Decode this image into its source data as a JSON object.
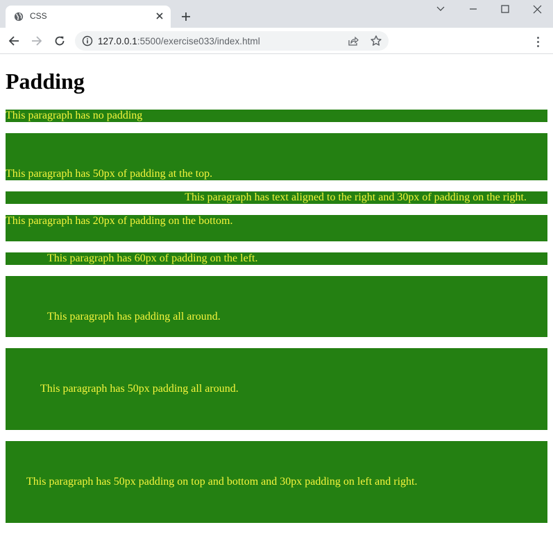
{
  "browser": {
    "tab": {
      "title": "CSS",
      "icon": "globe-icon"
    },
    "new_tab_label": "+",
    "address": {
      "host": "127.0.0.1",
      "rest": ":5500/exercise033/index.html"
    },
    "window_controls": [
      "chevron-down-icon",
      "minimize-icon",
      "maximize-icon",
      "close-icon"
    ]
  },
  "page": {
    "heading": "Padding",
    "paragraphs": [
      "This paragraph has no padding",
      "This paragraph has 50px of padding at the top.",
      "This paragraph has text aligned to the right and 30px of padding on the right.",
      "This paragraph has 20px of padding on the bottom.",
      "This paragraph has 60px of padding on the left.",
      "This paragraph has padding all around.",
      "This paragraph has 50px padding all around.",
      "This paragraph has 50px padding on top and bottom and 30px padding on left and right."
    ]
  },
  "colors": {
    "paragraph_bg": "#248012",
    "paragraph_text": "#f5f53d"
  }
}
